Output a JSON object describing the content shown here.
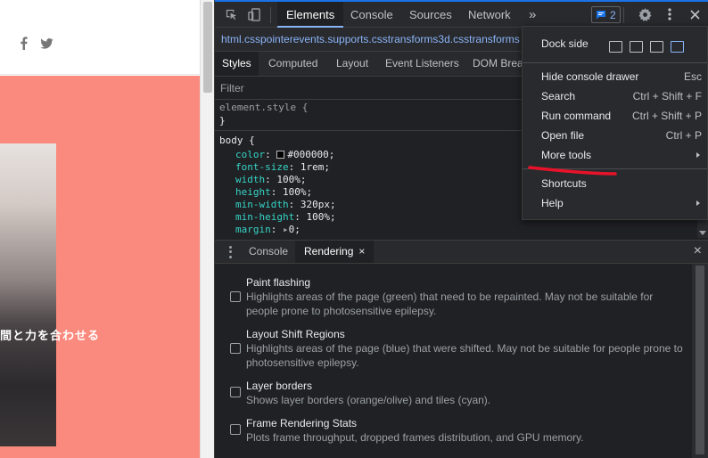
{
  "webpage": {
    "social_icons": [
      "facebook-icon",
      "twitter-icon"
    ],
    "hero_color": "#fb8a7e",
    "caption": "間と力を合わせる"
  },
  "devtools": {
    "main_tabs": [
      "Elements",
      "Console",
      "Sources",
      "Network"
    ],
    "more_tabs_glyph": "»",
    "issues_count": "2",
    "breadcrumb": {
      "tag": "html",
      "classes": ".csspointerevents.supports.csstransforms3d.csstransforms"
    },
    "style_tabs": [
      "Styles",
      "Computed",
      "Layout",
      "Event Listeners",
      "DOM Brea"
    ],
    "filter": {
      "placeholder": "Filter"
    },
    "styles": {
      "element_style": {
        "selector": "element.style {",
        "close": "}"
      },
      "body_rule": {
        "selector": "body {",
        "declarations": [
          {
            "prop": "color",
            "value": "#000000;"
          },
          {
            "prop": "font-size",
            "value": "1rem;"
          },
          {
            "prop": "width",
            "value": "100%;"
          },
          {
            "prop": "height",
            "value": "100%;"
          },
          {
            "prop": "min-width",
            "value": "320px;"
          },
          {
            "prop": "min-height",
            "value": "100%;"
          },
          {
            "prop": "margin",
            "value": "0;"
          }
        ]
      }
    },
    "drawer": {
      "tabs": [
        "Console",
        "Rendering"
      ],
      "close_glyph": "×",
      "rendering_options": [
        {
          "title": "Paint flashing",
          "description": "Highlights areas of the page (green) that need to be repainted. May not be suitable for people prone to photosensitive epilepsy."
        },
        {
          "title": "Layout Shift Regions",
          "description": "Highlights areas of the page (blue) that were shifted. May not be suitable for people prone to photosensitive epilepsy."
        },
        {
          "title": "Layer borders",
          "description": "Shows layer borders (orange/olive) and tiles (cyan)."
        },
        {
          "title": "Frame Rendering Stats",
          "description": "Plots frame throughput, dropped frames distribution, and GPU memory."
        }
      ]
    },
    "menu": {
      "dock_side_label": "Dock side",
      "items": [
        {
          "label": "Hide console drawer",
          "shortcut": "Esc"
        },
        {
          "label": "Search",
          "shortcut": "Ctrl + Shift + F"
        },
        {
          "label": "Run command",
          "shortcut": "Ctrl + Shift + P"
        },
        {
          "label": "Open file",
          "shortcut": "Ctrl + P"
        },
        {
          "label": "More tools",
          "shortcut": ""
        }
      ],
      "items2": [
        {
          "label": "Shortcuts",
          "shortcut": ""
        },
        {
          "label": "Help",
          "shortcut": ""
        }
      ],
      "annotation_color": "#e8132a"
    },
    "accent_color": "#8ab4f8"
  }
}
